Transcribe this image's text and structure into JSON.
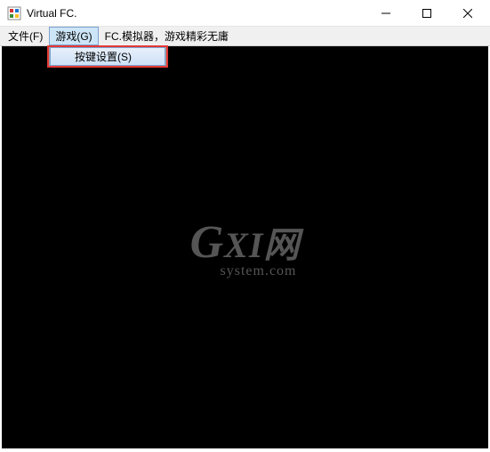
{
  "window": {
    "title": "Virtual FC."
  },
  "menubar": {
    "items": [
      {
        "label": "文件(F)"
      },
      {
        "label": "游戏(G)"
      },
      {
        "label": "FC.模拟器，游戏精彩无庸"
      }
    ],
    "open_index": 1
  },
  "dropdown": {
    "items": [
      {
        "label": "按键设置(S)"
      }
    ]
  },
  "watermark": {
    "main_prefix": "G",
    "main_rest": "XI网",
    "sub": "system.com"
  }
}
